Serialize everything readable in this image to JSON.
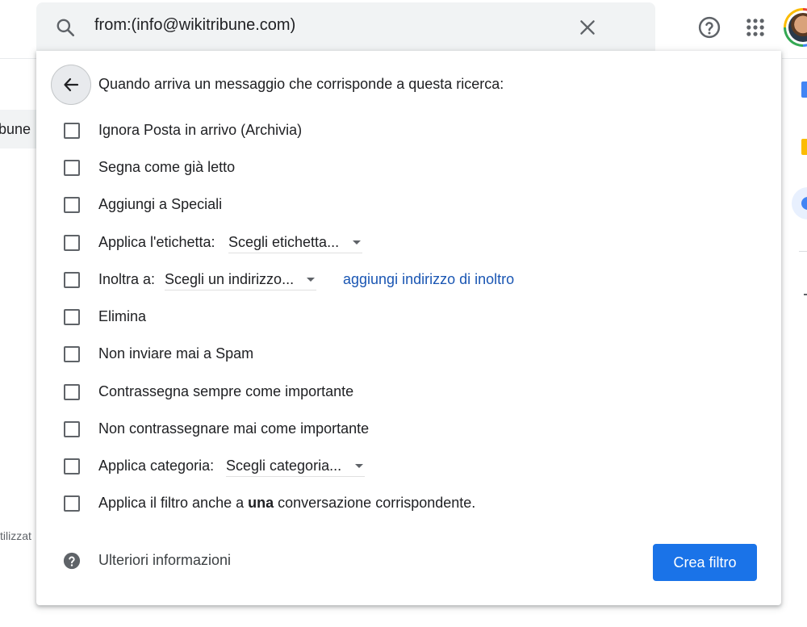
{
  "search": {
    "query": "from:(info@wikitribune.com)"
  },
  "background": {
    "tab_fragment": "bune",
    "footer_fragment": "tilizzat"
  },
  "filter": {
    "heading": "Quando arriva un messaggio che corrisponde a questa ricerca:",
    "options": [
      {
        "label": "Ignora Posta in arrivo (Archivia)",
        "checked": false
      },
      {
        "label": "Segna come già letto",
        "checked": false
      },
      {
        "label": "Aggiungi a Speciali",
        "checked": false
      },
      {
        "label": "Applica l'etichetta:",
        "checked": false,
        "dropdown": "Scegli etichetta..."
      },
      {
        "label": "Inoltra a:",
        "checked": false,
        "dropdown": "Scegli un indirizzo...",
        "link": "aggiungi indirizzo di inoltro"
      },
      {
        "label": "Elimina",
        "checked": false
      },
      {
        "label": "Non inviare mai a Spam",
        "checked": false
      },
      {
        "label": "Contrassegna sempre come importante",
        "checked": false
      },
      {
        "label": "Non contrassegnare mai come importante",
        "checked": false
      },
      {
        "label": "Applica categoria:",
        "checked": false,
        "dropdown": "Scegli categoria..."
      },
      {
        "label_before": "Applica il filtro anche a ",
        "label_bold": "una",
        "label_after": " conversazione corrispondente.",
        "checked": false
      }
    ],
    "info_link": "Ulteriori informazioni",
    "create_button": "Crea filtro"
  },
  "colors": {
    "primary_button": "#1a73e8",
    "link": "#1a56b3",
    "search_bg": "#f1f3f4"
  },
  "icons": [
    "search-icon",
    "close-icon",
    "help-icon",
    "apps-grid-icon",
    "arrow-back-icon",
    "question-circle-icon"
  ]
}
